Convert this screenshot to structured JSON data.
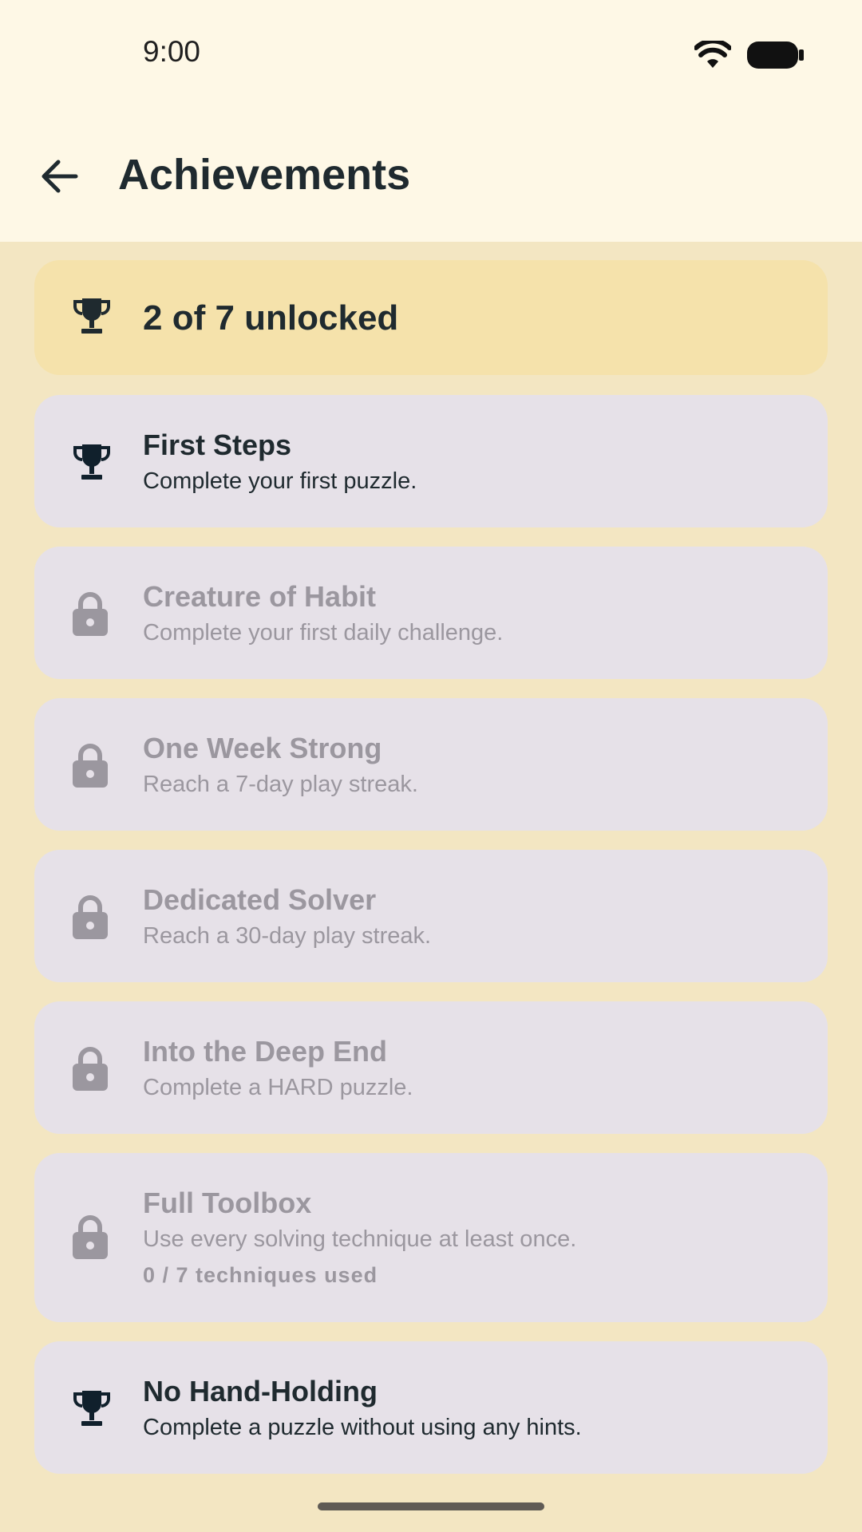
{
  "status_bar": {
    "time": "9:00",
    "icons": [
      "wifi-icon",
      "battery-icon"
    ]
  },
  "header": {
    "title": "Achievements",
    "back_icon": "back-arrow-icon"
  },
  "summary": {
    "text": "2 of 7 unlocked",
    "icon": "trophy-icon"
  },
  "achievements": [
    {
      "name": "First Steps",
      "description": "Complete your first puzzle.",
      "unlocked": true
    },
    {
      "name": "Creature of Habit",
      "description": "Complete your first daily challenge.",
      "unlocked": false
    },
    {
      "name": "One Week Strong",
      "description": "Reach a 7-day play streak.",
      "unlocked": false
    },
    {
      "name": "Dedicated Solver",
      "description": "Reach a 30-day play streak.",
      "unlocked": false
    },
    {
      "name": "Into the Deep End",
      "description": "Complete a HARD puzzle.",
      "unlocked": false
    },
    {
      "name": "Full Toolbox",
      "description": "Use every solving technique at least once.",
      "progress": "0 / 7 techniques used",
      "unlocked": false
    },
    {
      "name": "No Hand-Holding",
      "description": "Complete a puzzle without using any hints.",
      "unlocked": true
    }
  ],
  "colors": {
    "background": "#f3e6c2",
    "header": "#fef8e6",
    "summary_card": "#f5e2ab",
    "card": "#e6e1e8",
    "trophy": "#10202c",
    "locked": "#9b979f"
  }
}
